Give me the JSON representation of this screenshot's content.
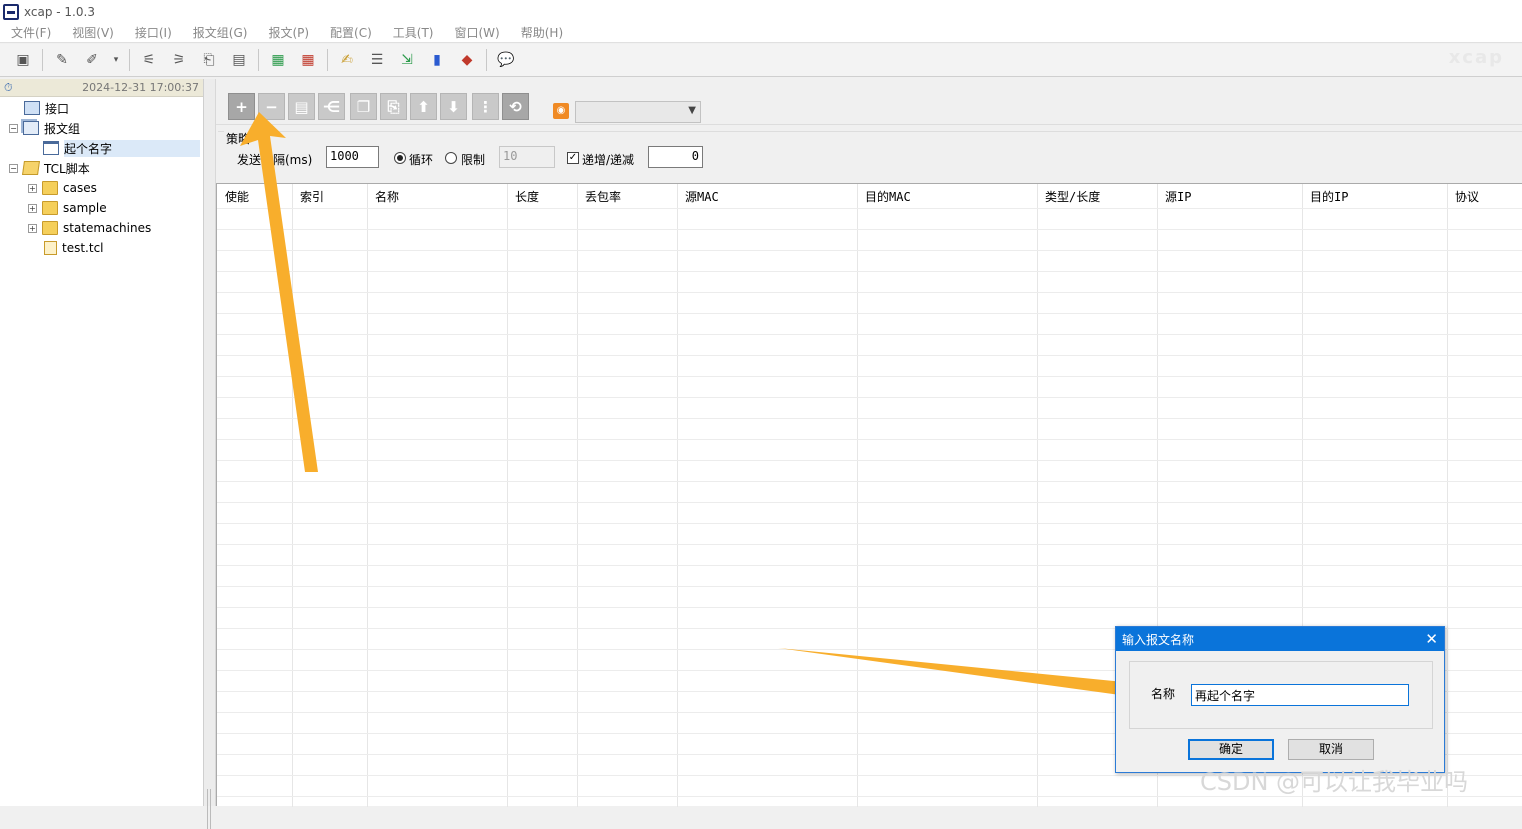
{
  "window": {
    "title": "xcap - 1.0.3"
  },
  "menu": [
    "文件(F)",
    "视图(V)",
    "接口(I)",
    "报文组(G)",
    "报文(P)",
    "配置(C)",
    "工具(T)",
    "窗口(W)",
    "帮助(H)"
  ],
  "sidebar": {
    "timestamp": "2024-12-31  17:00:37",
    "tree": [
      {
        "label": "接口",
        "icon": "monitor-icon",
        "indent": 0,
        "expander": ""
      },
      {
        "label": "报文组",
        "icon": "group-icon",
        "indent": 0,
        "expander": "−"
      },
      {
        "label": "起个名字",
        "icon": "window-icon",
        "indent": 1,
        "expander": "",
        "selected": true
      },
      {
        "label": "TCL脚本",
        "icon": "script-icon",
        "indent": 0,
        "expander": "−"
      },
      {
        "label": "cases",
        "icon": "folder-icon",
        "indent": 1,
        "expander": "+"
      },
      {
        "label": "sample",
        "icon": "folder-icon",
        "indent": 1,
        "expander": "+"
      },
      {
        "label": "statemachines",
        "icon": "folder-icon",
        "indent": 1,
        "expander": "+"
      },
      {
        "label": "test.tcl",
        "icon": "file-icon",
        "indent": 1,
        "expander": ""
      }
    ]
  },
  "policy": {
    "legend": "策略",
    "interval_label": "发送间隔(ms)",
    "interval_value": "1000",
    "loop_label": "循环",
    "limit_label": "限制",
    "limit_value": "10",
    "step_label": "递增/递减",
    "step_value": "0"
  },
  "table": {
    "columns": [
      "使能",
      "索引",
      "名称",
      "长度",
      "丢包率",
      "源MAC",
      "目的MAC",
      "类型/长度",
      "源IP",
      "目的IP",
      "协议"
    ]
  },
  "dialog": {
    "title": "输入报文名称",
    "close": "✕",
    "label": "名称",
    "value": "再起个名字",
    "ok": "确定",
    "cancel": "取消"
  },
  "watermark": "CSDN @可以让我毕业吗",
  "logo": "xcap",
  "colors": {
    "accent": "#0a74da",
    "arrow": "#f8ae2c",
    "rss": "#f08a24"
  }
}
